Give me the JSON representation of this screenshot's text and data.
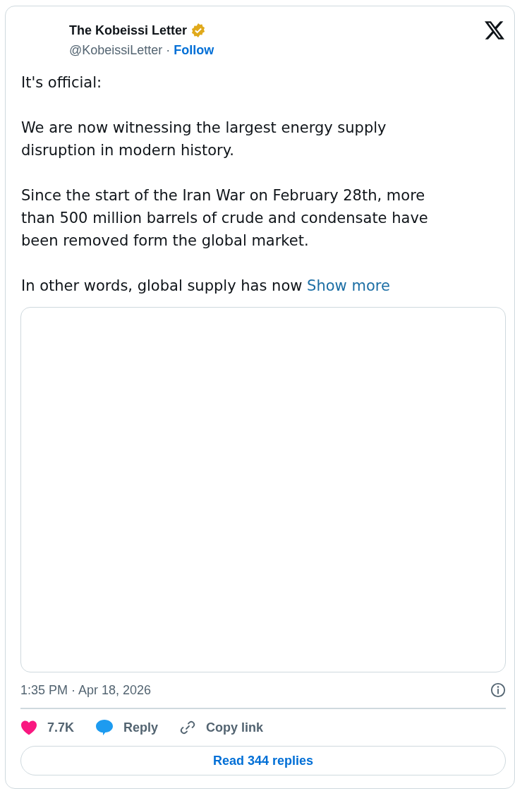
{
  "author": {
    "name": "The Kobeissi Letter",
    "verified": true,
    "handle": "@KobeissiLetter",
    "separator": "·",
    "follow": "Follow"
  },
  "paragraphs": [
    "It's official:",
    "We are now witnessing the largest energy supply disruption in modern history.",
    "Since the start of the Iran War on February 28th, more than 500 million barrels of crude and condensate have been removed form the global market.",
    "In other words, global supply has now"
  ],
  "show_more": "Show more",
  "timestamp": "1:35 PM · Apr 18, 2026",
  "actions": [
    {
      "kind": "like",
      "label": "7.7K"
    },
    {
      "kind": "reply",
      "label": "Reply"
    },
    {
      "kind": "copy",
      "label": "Copy link"
    }
  ],
  "read_replies": "Read 344 replies"
}
